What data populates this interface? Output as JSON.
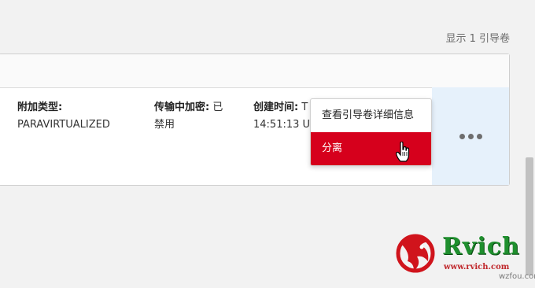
{
  "summary": {
    "count_label": "显示 1 引导卷"
  },
  "row": {
    "attach_type": {
      "label": "附加类型:",
      "value": "PARAVIRTUALIZED"
    },
    "in_transit_encryption": {
      "label": "传输中加密:",
      "value_first": "已",
      "value_rest": "禁用"
    },
    "created": {
      "label": "创建时间:",
      "label_suffix": "T",
      "value": "14:51:13 UTC"
    }
  },
  "context_menu": {
    "items": [
      {
        "label": "查看引导卷详细信息"
      },
      {
        "label": "分离",
        "color": "#d6001c"
      }
    ]
  },
  "actions": {
    "icon": "more-horizontal-icon"
  },
  "watermark": {
    "title": "Rvich",
    "url": "www.rvich.com",
    "sub": "wzfou.com"
  }
}
